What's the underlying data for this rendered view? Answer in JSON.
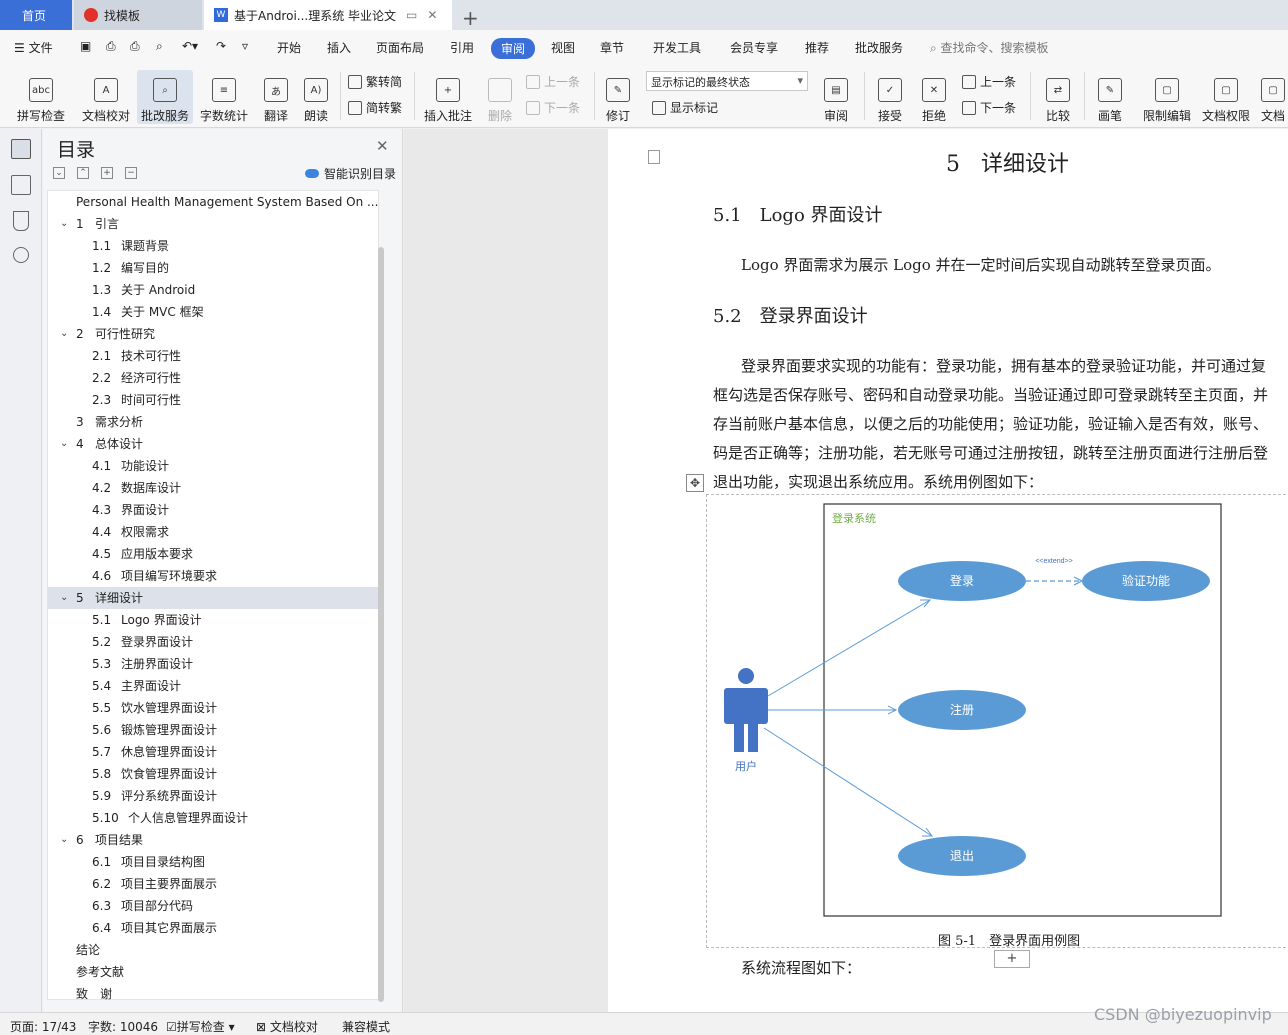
{
  "tabs": {
    "home": "首页",
    "template": "找模板",
    "document": "基于Androi...理系统 毕业论文"
  },
  "menu": {
    "file": "文件",
    "items": [
      "开始",
      "插入",
      "页面布局",
      "引用",
      "审阅",
      "视图",
      "章节",
      "开发工具",
      "会员专享",
      "推荐",
      "批改服务"
    ],
    "active": "审阅",
    "search": "查找命令、搜索模板"
  },
  "ribbon": {
    "spellcheck": "拼写检查",
    "doc_proof": "文档校对",
    "correction_service": "批改服务",
    "word_count": "字数统计",
    "translate": "翻译",
    "read_aloud": "朗读",
    "trad_to_simp": "繁转简",
    "simp_to_trad": "简转繁",
    "insert_comment": "插入批注",
    "delete": "删除",
    "prev_comment": "上一条",
    "next_comment": "下一条",
    "track": "修订",
    "markup_state": "显示标记的最终状态",
    "show_markup": "显示标记",
    "review": "审阅",
    "accept": "接受",
    "reject": "拒绝",
    "prev_change": "上一条",
    "next_change": "下一条",
    "compare": "比较",
    "pen": "画笔",
    "restrict_edit": "限制编辑",
    "doc_permission": "文档权限",
    "doc_cut": "文档"
  },
  "toc": {
    "title": "目录",
    "smart": "智能识别目录",
    "items": [
      {
        "num": "",
        "text": "Personal Health Management System Based On ...",
        "level": 0,
        "chev": false
      },
      {
        "num": "1",
        "text": "引言",
        "level": 1,
        "chev": true
      },
      {
        "num": "1.1",
        "text": "课题背景",
        "level": 2
      },
      {
        "num": "1.2",
        "text": "编写目的",
        "level": 2
      },
      {
        "num": "1.3",
        "text": "关于 Android",
        "level": 2
      },
      {
        "num": "1.4",
        "text": "关于 MVC 框架",
        "level": 2
      },
      {
        "num": "2",
        "text": "可行性研究",
        "level": 1,
        "chev": true
      },
      {
        "num": "2.1",
        "text": "技术可行性",
        "level": 2
      },
      {
        "num": "2.2",
        "text": "经济可行性",
        "level": 2
      },
      {
        "num": "2.3",
        "text": "时间可行性",
        "level": 2
      },
      {
        "num": "3",
        "text": "需求分析",
        "level": 1,
        "chev": false
      },
      {
        "num": "4",
        "text": "总体设计",
        "level": 1,
        "chev": true
      },
      {
        "num": "4.1",
        "text": "功能设计",
        "level": 2
      },
      {
        "num": "4.2",
        "text": "数据库设计",
        "level": 2
      },
      {
        "num": "4.3",
        "text": "界面设计",
        "level": 2
      },
      {
        "num": "4.4",
        "text": "权限需求",
        "level": 2
      },
      {
        "num": "4.5",
        "text": "应用版本要求",
        "level": 2
      },
      {
        "num": "4.6",
        "text": "项目编写环境要求",
        "level": 2
      },
      {
        "num": "5",
        "text": "详细设计",
        "level": 1,
        "chev": true,
        "selected": true
      },
      {
        "num": "5.1",
        "text": "Logo 界面设计",
        "level": 2
      },
      {
        "num": "5.2",
        "text": "登录界面设计",
        "level": 2
      },
      {
        "num": "5.3",
        "text": "注册界面设计",
        "level": 2
      },
      {
        "num": "5.4",
        "text": "主界面设计",
        "level": 2
      },
      {
        "num": "5.5",
        "text": "饮水管理界面设计",
        "level": 2
      },
      {
        "num": "5.6",
        "text": "锻炼管理界面设计",
        "level": 2
      },
      {
        "num": "5.7",
        "text": "休息管理界面设计",
        "level": 2
      },
      {
        "num": "5.8",
        "text": "饮食管理界面设计",
        "level": 2
      },
      {
        "num": "5.9",
        "text": "评分系统界面设计",
        "level": 2
      },
      {
        "num": "5.10",
        "text": "个人信息管理界面设计",
        "level": 2
      },
      {
        "num": "6",
        "text": "项目结果",
        "level": 1,
        "chev": true
      },
      {
        "num": "6.1",
        "text": "项目目录结构图",
        "level": 2
      },
      {
        "num": "6.2",
        "text": "项目主要界面展示",
        "level": 2
      },
      {
        "num": "6.3",
        "text": "项目部分代码",
        "level": 2
      },
      {
        "num": "6.4",
        "text": "项目其它界面展示",
        "level": 2
      },
      {
        "num": "",
        "text": "结论",
        "level": 0,
        "chev": false
      },
      {
        "num": "",
        "text": "参考文献",
        "level": 0,
        "chev": false
      },
      {
        "num": "",
        "text": "致　谢",
        "level": 0,
        "chev": false
      }
    ]
  },
  "doc": {
    "h1_num": "5",
    "h1_text": "详细设计",
    "h2_1": "5.1　Logo 界面设计",
    "p1": "Logo 界面需求为展示 Logo 并在一定时间后实现自动跳转至登录页面。",
    "h2_2": "5.2　登录界面设计",
    "p2_lines": [
      "登录界面要求实现的功能有：登录功能，拥有基本的登录验证功能，并可通过复",
      "框勾选是否保存账号、密码和自动登录功能。当验证通过即可登录跳转至主页面，并",
      "存当前账户基本信息，以便之后的功能使用；验证功能，验证输入是否有效，账号、",
      "码是否正确等；注册功能，若无账号可通过注册按钮，跳转至注册页面进行注册后登",
      "退出功能，实现退出系统应用。系统用例图如下："
    ],
    "figure": {
      "system": "登录系统",
      "login": "登录",
      "verify": "验证功能",
      "register": "注册",
      "logout": "退出",
      "extend": "<<extend>>",
      "actor": "用户",
      "caption": "图 5-1　登录界面用例图"
    },
    "p3": "系统流程图如下：",
    "add": "+"
  },
  "status": {
    "page": "页面: 17/43",
    "words": "字数: 10046",
    "spell": "拼写检查",
    "proof": "文档校对",
    "compat": "兼容模式"
  },
  "watermark": "CSDN @biyezuopinvip",
  "colors": {
    "accent": "#3b6fd8",
    "usecase": "#5b9bd5",
    "actor": "#4472c4",
    "system_label": "#70ad47"
  }
}
